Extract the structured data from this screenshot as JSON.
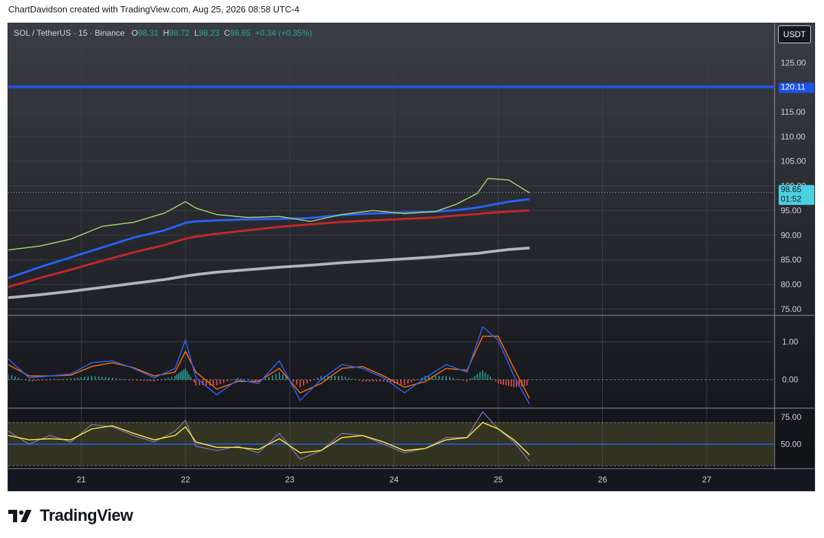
{
  "header": {
    "attribution": "ChartDavidson created with TradingView.com, Aug 25, 2026 08:58 UTC-4"
  },
  "legend": {
    "symbol": "SOL / TetherUS · 15 · Binance",
    "o_label": "O",
    "o_value": "98.31",
    "h_label": "H",
    "h_value": "98.72",
    "l_label": "L",
    "l_value": "98.23",
    "c_label": "C",
    "c_value": "98.65",
    "change": "+0.34 (+0.35%)"
  },
  "currency_button": "USDT",
  "footer": {
    "brand": "TradingView",
    "logo_icon": "tradingview-logo-icon"
  },
  "colors": {
    "background": "#131722",
    "grid": "#2a2e39",
    "ema_green": "#a5d66b",
    "ema_blue": "#2962ff",
    "ema_red": "#c62828",
    "ema_white": "#b2b5be",
    "resistance_line": "#1e53e5",
    "macd_line": "#2962ff",
    "signal_line": "#ff6d00",
    "rsi_line": "#9575cd",
    "rsi_ma": "#ffeb3b",
    "hist_up": "#26a69a",
    "hist_down": "#ef5350"
  },
  "chart_data": {
    "type": "line",
    "title": "SOL / TetherUS · 15 · Binance",
    "x_ticks": [
      "21",
      "22",
      "23",
      "24",
      "25",
      "26",
      "27"
    ],
    "price_panel": {
      "y_ticks": [
        "125.00",
        "115.00",
        "110.00",
        "105.00",
        "100.00",
        "95.00",
        "90.00",
        "85.00",
        "80.00",
        "75.00"
      ],
      "ylim": [
        74,
        133
      ],
      "price_label": "98.65",
      "countdown_label": "01:52",
      "resistance_label": "120.11",
      "resistance_value": 120.11,
      "last_price": 98.65,
      "x": [
        20.3,
        20.6,
        20.9,
        21.2,
        21.5,
        21.8,
        22.0,
        22.1,
        22.3,
        22.6,
        22.9,
        23.2,
        23.5,
        23.8,
        24.1,
        24.4,
        24.6,
        24.8,
        24.9,
        25.1,
        25.3
      ],
      "series": [
        {
          "values": [
            87.0,
            87.8,
            89.2,
            91.8,
            92.6,
            94.5,
            96.8,
            95.5,
            94.2,
            93.6,
            93.8,
            92.8,
            94.2,
            95.0,
            94.4,
            94.8,
            96.3,
            98.5,
            101.5,
            101.2,
            98.6
          ]
        },
        {
          "values": [
            81.3,
            83.5,
            85.5,
            87.5,
            89.5,
            91.0,
            92.5,
            92.8,
            93.0,
            93.2,
            93.3,
            93.5,
            94.1,
            94.4,
            94.6,
            94.8,
            95.1,
            95.6,
            96.0,
            96.8,
            97.3
          ]
        },
        {
          "values": [
            79.5,
            81.3,
            83.0,
            84.8,
            86.5,
            88.0,
            89.3,
            89.7,
            90.3,
            91.0,
            91.7,
            92.2,
            92.7,
            93.0,
            93.3,
            93.6,
            94.0,
            94.3,
            94.5,
            94.8,
            95.0
          ]
        },
        {
          "values": [
            77.3,
            77.9,
            78.6,
            79.4,
            80.2,
            81.0,
            81.7,
            82.0,
            82.5,
            83.0,
            83.5,
            83.9,
            84.4,
            84.8,
            85.2,
            85.6,
            86.0,
            86.3,
            86.6,
            87.1,
            87.4
          ]
        }
      ]
    },
    "macd_panel": {
      "y_ticks": [
        "1.00",
        "0.00"
      ],
      "ylim": [
        -0.7,
        1.65
      ],
      "x": [
        20.3,
        20.5,
        20.7,
        20.9,
        21.1,
        21.3,
        21.5,
        21.7,
        21.9,
        22.0,
        22.1,
        22.3,
        22.5,
        22.7,
        22.9,
        23.1,
        23.3,
        23.5,
        23.7,
        23.9,
        24.1,
        24.3,
        24.5,
        24.7,
        24.85,
        25.0,
        25.15,
        25.3
      ],
      "series": [
        {
          "values": [
            0.55,
            0.05,
            0.1,
            0.15,
            0.45,
            0.5,
            0.3,
            0.05,
            0.3,
            1.05,
            0.05,
            -0.4,
            0.0,
            -0.1,
            0.5,
            -0.55,
            0.0,
            0.4,
            0.3,
            0.05,
            -0.35,
            0.05,
            0.4,
            0.2,
            1.4,
            1.05,
            0.1,
            -0.65
          ]
        },
        {
          "values": [
            0.4,
            0.1,
            0.1,
            0.12,
            0.35,
            0.45,
            0.32,
            0.1,
            0.2,
            0.75,
            0.2,
            -0.25,
            -0.05,
            -0.05,
            0.3,
            -0.35,
            -0.1,
            0.3,
            0.35,
            0.1,
            -0.2,
            -0.05,
            0.3,
            0.25,
            1.15,
            1.15,
            0.3,
            -0.5
          ]
        }
      ]
    },
    "rsi_panel": {
      "y_ticks": [
        "75.00",
        "50.00"
      ],
      "ylim": [
        28,
        82
      ],
      "x": [
        20.3,
        20.5,
        20.7,
        20.9,
        21.1,
        21.3,
        21.5,
        21.7,
        21.9,
        22.0,
        22.1,
        22.3,
        22.5,
        22.7,
        22.9,
        23.1,
        23.3,
        23.5,
        23.7,
        23.9,
        24.1,
        24.3,
        24.5,
        24.7,
        24.85,
        25.0,
        25.15,
        25.3
      ],
      "series": [
        {
          "values": [
            62,
            50,
            58,
            52,
            68,
            66,
            58,
            52,
            62,
            72,
            48,
            44,
            48,
            42,
            60,
            36,
            44,
            60,
            58,
            50,
            42,
            46,
            56,
            56,
            80,
            64,
            52,
            34
          ]
        },
        {
          "values": [
            58,
            54,
            55,
            54,
            64,
            67,
            60,
            54,
            58,
            66,
            52,
            47,
            47,
            45,
            55,
            42,
            44,
            56,
            58,
            52,
            44,
            46,
            54,
            56,
            70,
            64,
            54,
            40
          ]
        }
      ]
    }
  }
}
